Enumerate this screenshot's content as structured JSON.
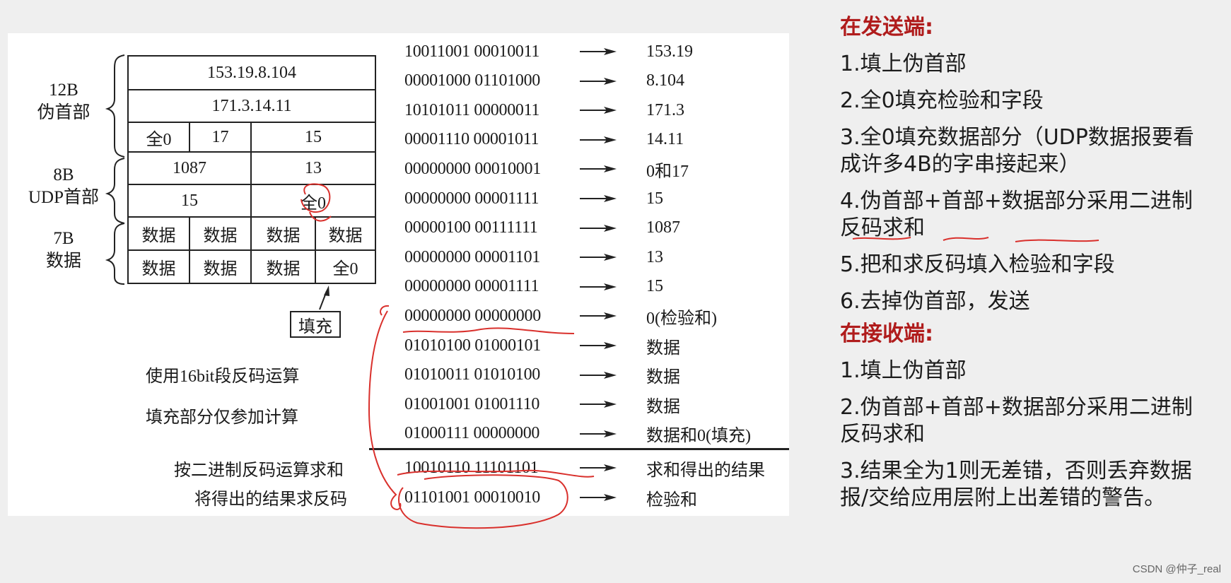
{
  "diagram": {
    "table": {
      "rows": [
        {
          "cells": [
            "153.19.8.104"
          ]
        },
        {
          "cells": [
            "171.3.14.11"
          ]
        },
        {
          "cells": [
            "全0",
            "17",
            "15"
          ]
        },
        {
          "cells": [
            "1087",
            "13"
          ]
        },
        {
          "cells": [
            "15",
            "全0"
          ]
        },
        {
          "cells": [
            "数据",
            "数据",
            "数据",
            "数据"
          ]
        },
        {
          "cells": [
            "数据",
            "数据",
            "数据",
            "全0"
          ]
        }
      ]
    },
    "groups": [
      {
        "size": "12B",
        "name": "伪首部"
      },
      {
        "size": "8B",
        "name": "UDP首部"
      },
      {
        "size": "7B",
        "name": "数据"
      }
    ],
    "fill_label": "填充",
    "notes": {
      "use_16bit": "使用16bit段反码运算",
      "fill_only_calc": "填充部分仅参加计算",
      "sum_label": "按二进制反码运算求和",
      "invert_label": "将得出的结果求反码"
    },
    "binary_rows": [
      {
        "bin": "10011001 00010011",
        "desc": "153.19"
      },
      {
        "bin": "00001000 01101000",
        "desc": "8.104"
      },
      {
        "bin": "10101011 00000011",
        "desc": "171.3"
      },
      {
        "bin": "00001110 00001011",
        "desc": "14.11"
      },
      {
        "bin": "00000000 00010001",
        "desc": "0和17"
      },
      {
        "bin": "00000000 00001111",
        "desc": "15"
      },
      {
        "bin": "00000100 00111111",
        "desc": "1087"
      },
      {
        "bin": "00000000 00001101",
        "desc": "13"
      },
      {
        "bin": "00000000 00001111",
        "desc": "15"
      },
      {
        "bin": "00000000 00000000",
        "desc": "0(检验和)"
      },
      {
        "bin": "01010100 01000101",
        "desc": "数据"
      },
      {
        "bin": "01010011 01010100",
        "desc": "数据"
      },
      {
        "bin": "01001001 01001110",
        "desc": "数据"
      },
      {
        "bin": "01000111 00000000",
        "desc": "数据和0(填充)"
      }
    ],
    "result_rows": [
      {
        "bin": "10010110 11101101",
        "desc": "求和得出的结果"
      },
      {
        "bin": "01101001 00010010",
        "desc": "检验和"
      }
    ]
  },
  "sender": {
    "title": "在发送端:",
    "steps": [
      "1.填上伪首部",
      "2.全0填充检验和字段",
      "3.全0填充数据部分（UDP数据报要看成许多4B的字串接起来）",
      "4.伪首部+首部+数据部分采用二进制反码求和",
      "5.把和求反码填入检验和字段",
      "6.去掉伪首部，发送"
    ]
  },
  "receiver": {
    "title": "在接收端:",
    "steps": [
      "1.填上伪首部",
      "2.伪首部+首部+数据部分采用二进制反码求和",
      "3.结果全为1则无差错，否则丢弃数据报/交给应用层附上出差错的警告。"
    ]
  },
  "watermark": "CSDN @仲子_real",
  "colors": {
    "accent_red": "#b01c1c",
    "annotation_red": "#d9302c"
  }
}
